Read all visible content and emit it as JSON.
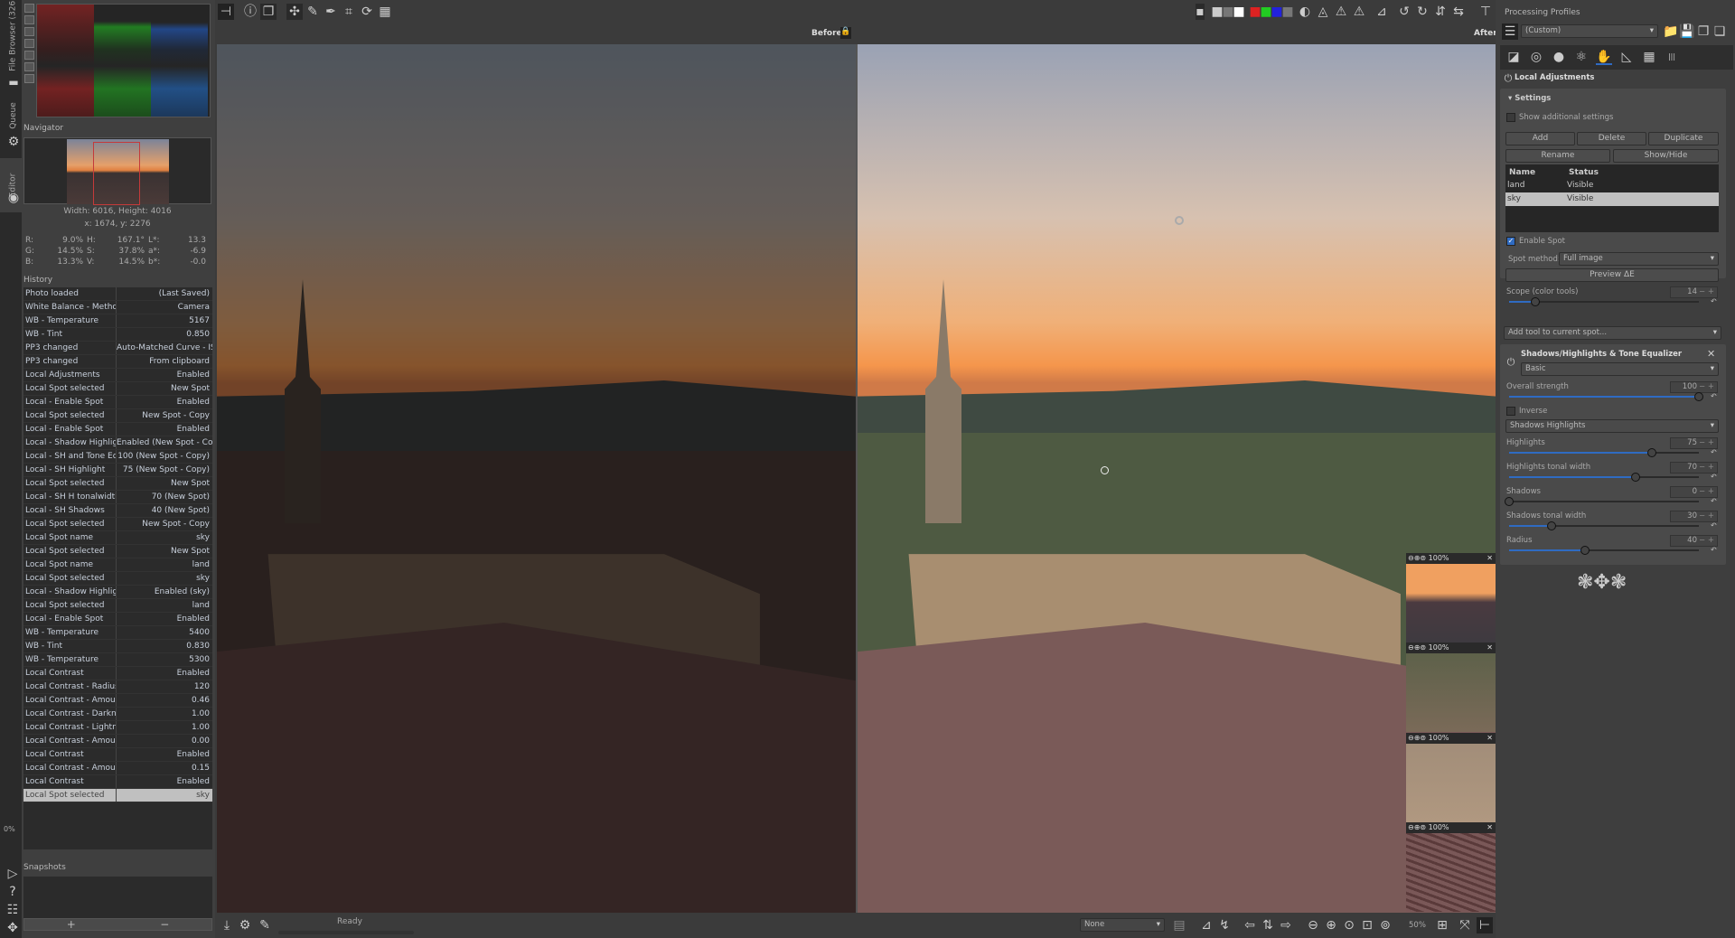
{
  "vertical_tabs": [
    {
      "label": "File Browser (326)"
    },
    {
      "label": "Queue"
    },
    {
      "label": "Editor"
    }
  ],
  "queue_progress": "0%",
  "navigator": {
    "title": "Navigator",
    "dimensions": "Width: 6016, Height: 4016",
    "coords": "x: 1674, y: 2276",
    "values": [
      [
        {
          "k": "R:",
          "v": "9.0%"
        },
        {
          "k": "H:",
          "v": "167.1°"
        },
        {
          "k": "L*:",
          "v": "13.3"
        }
      ],
      [
        {
          "k": "G:",
          "v": "14.5%"
        },
        {
          "k": "S:",
          "v": "37.8%"
        },
        {
          "k": "a*:",
          "v": "-6.9"
        }
      ],
      [
        {
          "k": "B:",
          "v": "13.3%"
        },
        {
          "k": "V:",
          "v": "14.5%"
        },
        {
          "k": "b*:",
          "v": "-0.0"
        }
      ]
    ]
  },
  "history": {
    "title": "History",
    "rows": [
      [
        "Photo loaded",
        "(Last Saved)"
      ],
      [
        "White Balance - Method",
        "Camera"
      ],
      [
        "WB - Temperature",
        "5167"
      ],
      [
        "WB - Tint",
        "0.850"
      ],
      [
        "PP3 changed",
        "Auto-Matched Curve - IS..."
      ],
      [
        "PP3 changed",
        "From clipboard"
      ],
      [
        "Local Adjustments",
        "Enabled"
      ],
      [
        "Local Spot selected",
        "New Spot"
      ],
      [
        "Local - Enable Spot",
        "Enabled"
      ],
      [
        "Local Spot selected",
        "New Spot - Copy"
      ],
      [
        "Local - Enable Spot",
        "Enabled"
      ],
      [
        "Local - Shadow Highlight",
        "Enabled (New Spot - Copy)"
      ],
      [
        "Local - SH and Tone Equ...",
        "100 (New Spot - Copy)"
      ],
      [
        "Local - SH Highlight",
        "75 (New Spot - Copy)"
      ],
      [
        "Local Spot selected",
        "New Spot"
      ],
      [
        "Local - SH H tonalwidth",
        "70 (New Spot)"
      ],
      [
        "Local - SH Shadows",
        "40 (New Spot)"
      ],
      [
        "Local Spot selected",
        "New Spot - Copy"
      ],
      [
        "Local Spot name",
        "sky"
      ],
      [
        "Local Spot selected",
        "New Spot"
      ],
      [
        "Local Spot name",
        "land"
      ],
      [
        "Local Spot selected",
        "sky"
      ],
      [
        "Local - Shadow Highlight",
        "Enabled (sky)"
      ],
      [
        "Local Spot selected",
        "land"
      ],
      [
        "Local - Enable Spot",
        "Enabled"
      ],
      [
        "WB - Temperature",
        "5400"
      ],
      [
        "WB - Tint",
        "0.830"
      ],
      [
        "WB - Temperature",
        "5300"
      ],
      [
        "Local Contrast",
        "Enabled"
      ],
      [
        "Local Contrast - Radius",
        "120"
      ],
      [
        "Local Contrast - Amount",
        "0.46"
      ],
      [
        "Local Contrast - Darkness",
        "1.00"
      ],
      [
        "Local Contrast - Lightness",
        "1.00"
      ],
      [
        "Local Contrast - Amount",
        "0.00"
      ],
      [
        "Local Contrast",
        "Enabled"
      ],
      [
        "Local Contrast - Amount",
        "0.15"
      ],
      [
        "Local Contrast",
        "Enabled"
      ],
      [
        "Local Spot selected",
        "sky"
      ]
    ],
    "selected_index": 37
  },
  "snapshots": {
    "title": "Snapshots",
    "add": "+",
    "remove": "−"
  },
  "viewer": {
    "before_label": "Before",
    "after_label": "After",
    "status": "Ready",
    "zoom": "50%",
    "background_select": "None"
  },
  "detail_windows": [
    {
      "zoom": "100%"
    },
    {
      "zoom": "100%"
    },
    {
      "zoom": "100%"
    },
    {
      "zoom": "100%"
    }
  ],
  "right_panel": {
    "profiles_title": "Processing Profiles",
    "profile": "(Custom)",
    "tool_tab_active": "local-adjustments",
    "local_adjustments_title": "Local Adjustments",
    "settings_title": "Settings",
    "show_additional": "Show additional settings",
    "buttons": {
      "add": "Add",
      "delete": "Delete",
      "duplicate": "Duplicate",
      "rename": "Rename",
      "showhide": "Show/Hide"
    },
    "spot_table": {
      "headers": [
        "Name",
        "Status"
      ],
      "rows": [
        [
          "land",
          "Visible"
        ],
        [
          "sky",
          "Visible"
        ]
      ],
      "selected_index": 1
    },
    "enable_spot": "Enable Spot",
    "spot_method_label": "Spot method:",
    "spot_method": "Full image",
    "preview_de": "Preview ΔE",
    "scope": {
      "label": "Scope (color tools)",
      "value": "14",
      "min": 0,
      "max": 100
    },
    "add_tool": "Add tool to current spot...",
    "sh_panel": {
      "title": "Shadows/Highlights & Tone Equalizer",
      "mode": "Basic",
      "overall": {
        "label": "Overall strength",
        "value": "100",
        "min": 0,
        "max": 100
      },
      "inverse": "Inverse",
      "method": "Shadows Highlights",
      "sliders": [
        {
          "label": "Highlights",
          "value": "75",
          "min": 0,
          "max": 100
        },
        {
          "label": "Highlights tonal width",
          "value": "70",
          "min": 10,
          "max": 100
        },
        {
          "label": "Shadows",
          "value": "0",
          "min": 0,
          "max": 100
        },
        {
          "label": "Shadows tonal width",
          "value": "30",
          "min": 10,
          "max": 100
        },
        {
          "label": "Radius",
          "value": "40",
          "min": 0,
          "max": 100
        }
      ]
    }
  },
  "colors": {
    "accent": "#2f6bc2",
    "panel": "#3e3e3e",
    "selection": "#c0c0c0"
  }
}
